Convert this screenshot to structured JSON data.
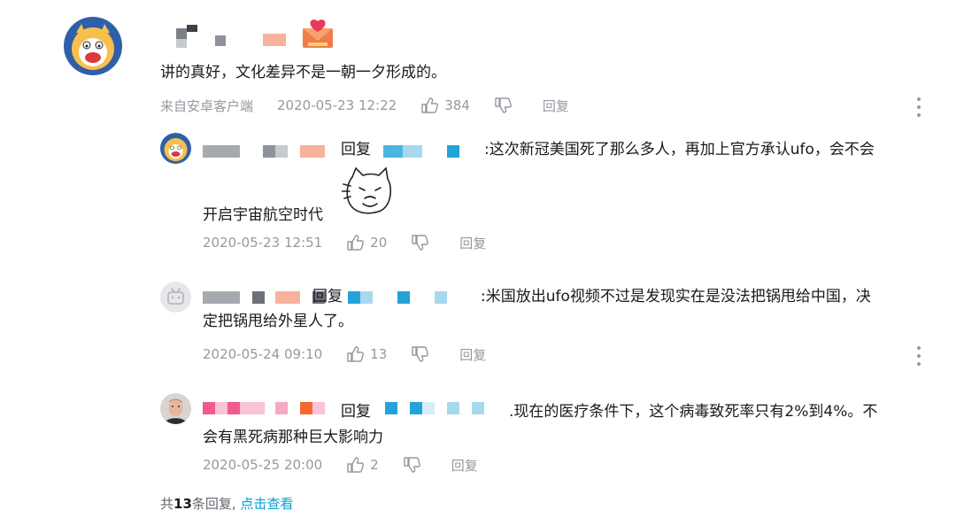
{
  "main_comment": {
    "text": "讲的真好，文化差异不是一朝一夕形成的。",
    "source": "来自安卓客户端",
    "time": "2020-05-23 12:22",
    "likes": "384",
    "reply_label": "回复"
  },
  "replies": [
    {
      "reply_word": "回复",
      "text_line1": ":这次新冠美国死了那么多人，再加上官方承认ufo，会不会",
      "text_line2": "开启宇宙航空时代",
      "time": "2020-05-23 12:51",
      "likes": "20",
      "reply_label": "回复"
    },
    {
      "reply_word": "回复",
      "text_line1": ":米国放出ufo视频不过是发现实在是没法把锅甩给中国，决",
      "text_line2": "定把锅甩给外星人了。",
      "time": "2020-05-24 09:10",
      "likes": "13",
      "reply_label": "回复"
    },
    {
      "reply_word": "回复",
      "text_line1": ".现在的医疗条件下，这个病毒致死率只有2%到4%。不",
      "text_line2": "会有黑死病那种巨大影响力",
      "time": "2020-05-25 20:00",
      "likes": "2",
      "reply_label": "回复"
    }
  ],
  "footer": {
    "prefix": "共",
    "count": "13",
    "suffix": "条回复,",
    "link": "点击查看"
  },
  "colors": {
    "text": "#18191c",
    "meta": "#9499a0",
    "link": "#00a1d6"
  }
}
